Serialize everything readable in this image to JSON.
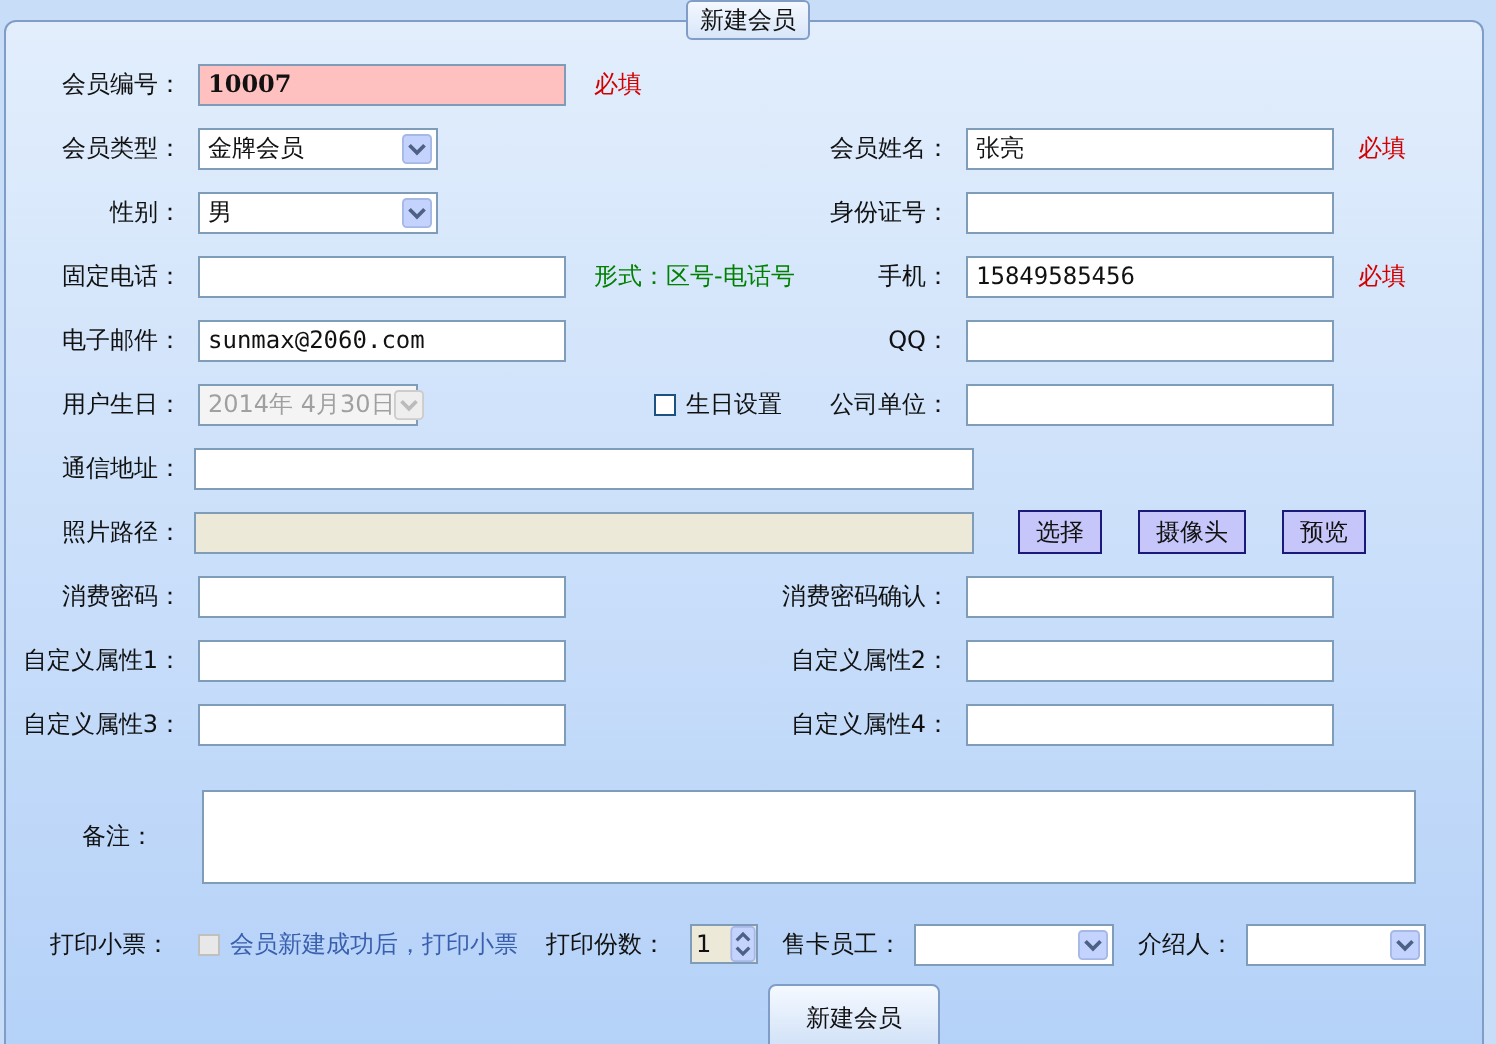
{
  "group_title": "新建会员",
  "rows": [
    {
      "kind": "pair",
      "left": {
        "label": "会员编号：",
        "kind": "text",
        "value": "10007",
        "highlighted": true,
        "note": {
          "kind": "required",
          "text": "必填"
        }
      }
    },
    {
      "kind": "pair",
      "left": {
        "label": "会员类型：",
        "kind": "select",
        "value": "金牌会员"
      },
      "right": {
        "label": "会员姓名：",
        "kind": "text",
        "value": "张亮",
        "note": {
          "kind": "required",
          "text": "必填"
        }
      }
    },
    {
      "kind": "pair",
      "left": {
        "label": "性别：",
        "kind": "select",
        "value": "男"
      },
      "right": {
        "label": "身份证号：",
        "kind": "text"
      }
    },
    {
      "kind": "pair",
      "left": {
        "label": "固定电话：",
        "kind": "text",
        "note": {
          "kind": "hint",
          "text": "形式：区号-电话号"
        }
      },
      "right": {
        "label": "手机：",
        "kind": "text",
        "value": "15849585456",
        "note": {
          "kind": "required",
          "text": "必填"
        }
      }
    },
    {
      "kind": "pair",
      "left": {
        "label": "电子邮件：",
        "kind": "text",
        "value": "sunmax@2060.com"
      },
      "right": {
        "label": "QQ：",
        "kind": "text"
      }
    },
    {
      "kind": "pair",
      "left": {
        "label": "用户生日：",
        "kind": "date",
        "value": "2014年 4月30日",
        "disabled": true,
        "note": {
          "kind": "checkbox",
          "text": "生日设置",
          "checked": false
        }
      },
      "right": {
        "label": "公司单位：",
        "kind": "text"
      }
    },
    {
      "kind": "wide",
      "label": "通信地址：",
      "disabled": false
    },
    {
      "kind": "wide",
      "label": "照片路径：",
      "disabled": true,
      "buttons": [
        "选择",
        "摄像头",
        "预览"
      ]
    },
    {
      "kind": "pair",
      "left": {
        "label": "消费密码：",
        "kind": "text"
      },
      "right": {
        "label": "消费密码确认：",
        "kind": "text"
      }
    },
    {
      "kind": "pair",
      "left": {
        "label": "自定义属性1：",
        "kind": "text"
      },
      "right": {
        "label": "自定义属性2：",
        "kind": "text"
      }
    },
    {
      "kind": "pair",
      "left": {
        "label": "自定义属性3：",
        "kind": "text"
      },
      "right": {
        "label": "自定义属性4：",
        "kind": "text"
      }
    },
    {
      "kind": "memo",
      "label": "备注："
    },
    {
      "kind": "print",
      "label": "打印小票：",
      "checkbox": {
        "text": "会员新建成功后，打印小票",
        "checked": false,
        "disabled": true
      },
      "copies": {
        "label": "打印份数：",
        "value": "1"
      },
      "selects": [
        {
          "label": "售卡员工："
        },
        {
          "label": "介绍人："
        }
      ]
    }
  ],
  "submit": "新建会员"
}
